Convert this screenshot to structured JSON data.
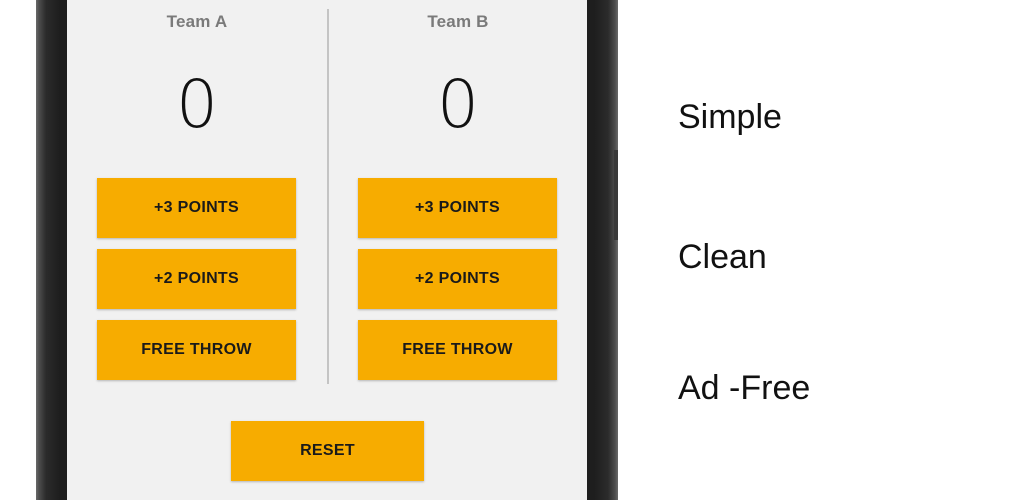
{
  "teams": [
    {
      "name": "Team A",
      "score": "0",
      "buttons": {
        "three": "+3 POINTS",
        "two": "+2 POINTS",
        "free_throw": "FREE THROW"
      }
    },
    {
      "name": "Team B",
      "score": "0",
      "buttons": {
        "three": "+3 POINTS",
        "two": "+2 POINTS",
        "free_throw": "FREE THROW"
      }
    }
  ],
  "reset_label": "RESET",
  "taglines": [
    "Simple",
    "Clean",
    "Ad -Free"
  ],
  "colors": {
    "button": "#f7ac00",
    "screen_background": "#f1f1f1",
    "phone_frame": "#1e1e1e",
    "team_name": "#7a7a7a"
  }
}
